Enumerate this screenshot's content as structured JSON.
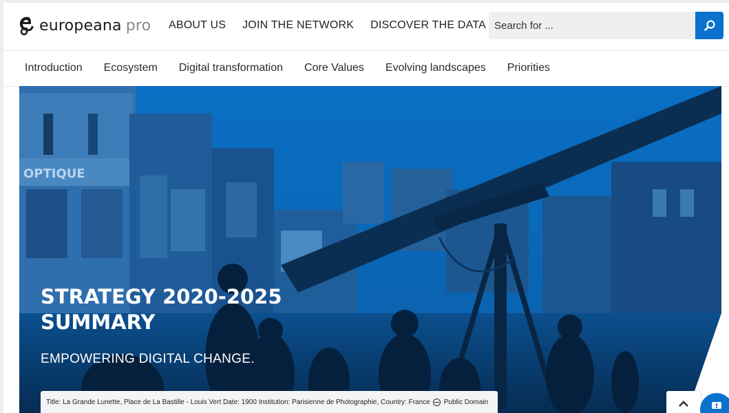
{
  "header": {
    "logo_text": "europeana",
    "logo_suffix": "pro",
    "nav": [
      {
        "label": "ABOUT US"
      },
      {
        "label": "JOIN THE NETWORK"
      },
      {
        "label": "DISCOVER THE DATA"
      }
    ],
    "search": {
      "placeholder": "Search for ...",
      "icon": "search-icon"
    }
  },
  "subnav": [
    {
      "label": "Introduction"
    },
    {
      "label": "Ecosystem"
    },
    {
      "label": "Digital transformation"
    },
    {
      "label": "Core Values"
    },
    {
      "label": "Evolving landscapes"
    },
    {
      "label": "Priorities"
    }
  ],
  "hero": {
    "title_line1": "STRATEGY 2020-2025",
    "title_line2": "SUMMARY",
    "subtitle": "EMPOWERING DIGITAL CHANGE.",
    "caption": "Title: La Grande Lunette, Place de La Bastille - Louis Vert  Date: 1900  Institution: Parisienne de Photographie,  Country: France",
    "rights": "Public Domain",
    "image_lettering": "OPTIQUE",
    "accent": "#0a72cc"
  },
  "controls": {
    "back_to_top_icon": "chevron-up-icon",
    "chat_icon": "chat-icon"
  }
}
